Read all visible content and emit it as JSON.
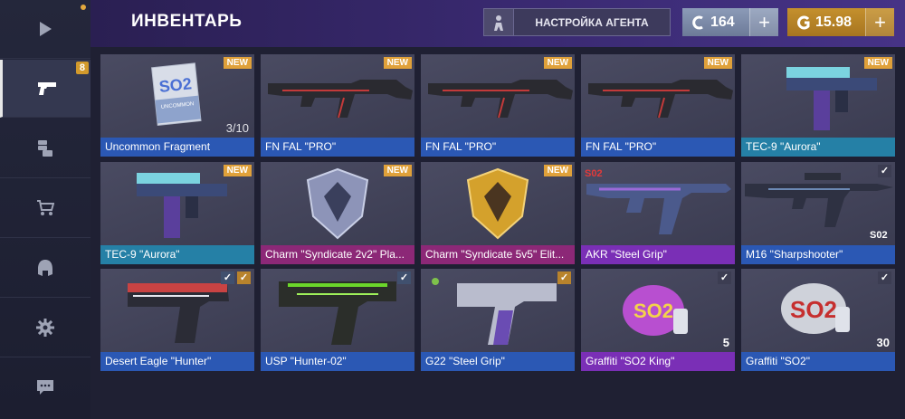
{
  "header": {
    "title": "ИНВЕНТАРЬ",
    "agent_button": "НАСТРОЙКА АГЕНТА",
    "silver_amount": "164",
    "gold_amount": "15.98",
    "plus": "+"
  },
  "sidebar": {
    "items": [
      {
        "name": "play",
        "icon": "play-icon"
      },
      {
        "name": "inventory",
        "icon": "pistol-icon",
        "badge": "8",
        "active": true
      },
      {
        "name": "cases",
        "icon": "coins-icon"
      },
      {
        "name": "market",
        "icon": "cart-icon"
      },
      {
        "name": "clan",
        "icon": "helmet-icon"
      },
      {
        "name": "settings",
        "icon": "gear-icon"
      },
      {
        "name": "chat",
        "icon": "chat-icon"
      }
    ]
  },
  "badges": {
    "new": "NEW",
    "check": "✓"
  },
  "items": [
    {
      "name": "Uncommon Fragment",
      "rarity": "blue",
      "new": true,
      "qty": "3/10"
    },
    {
      "name": "FN FAL \"PRO\"",
      "rarity": "blue",
      "new": true
    },
    {
      "name": "FN FAL \"PRO\"",
      "rarity": "blue",
      "new": true
    },
    {
      "name": "FN FAL \"PRO\"",
      "rarity": "blue",
      "new": true
    },
    {
      "name": "TEC-9 \"Aurora\"",
      "rarity": "teal",
      "new": true
    },
    {
      "name": "TEC-9 \"Aurora\"",
      "rarity": "teal",
      "new": true
    },
    {
      "name": "Charm \"Syndicate 2v2\" Pla...",
      "rarity": "pink",
      "new": true
    },
    {
      "name": "Charm \"Syndicate 5v5\" Elit...",
      "rarity": "pink",
      "new": true
    },
    {
      "name": "AKR \"Steel Grip\"",
      "rarity": "purple",
      "new": false,
      "sticker": "S02"
    },
    {
      "name": "M16 \"Sharpshooter\"",
      "rarity": "blue",
      "new": false,
      "check": true,
      "sticker": "S02"
    },
    {
      "name": "Desert Eagle \"Hunter\"",
      "rarity": "blue",
      "new": false,
      "check": true,
      "gold_check": true
    },
    {
      "name": "USP \"Hunter-02\"",
      "rarity": "blue",
      "new": false,
      "check": true
    },
    {
      "name": "G22 \"Steel Grip\"",
      "rarity": "blue",
      "new": false,
      "gold_check": true
    },
    {
      "name": "Graffiti \"SO2 King\"",
      "rarity": "purple",
      "new": false,
      "check": true,
      "qty": "5"
    },
    {
      "name": "Graffiti \"SO2\"",
      "rarity": "blue",
      "new": false,
      "check": true,
      "qty": "30"
    }
  ],
  "art_labels": {
    "fragment_logo": "SO2",
    "fragment_text": "UNCOMMON",
    "graffiti_king": "SO2",
    "graffiti_plain": "SO2"
  },
  "colors": {
    "new_badge": "#e0a13a",
    "rarity_blue": "#2b58b4",
    "rarity_teal": "#2580a6",
    "rarity_purple": "#7a2fb6",
    "rarity_pink": "#8c2877",
    "gold": "#c4902d",
    "silver": "#8c9bb8"
  }
}
